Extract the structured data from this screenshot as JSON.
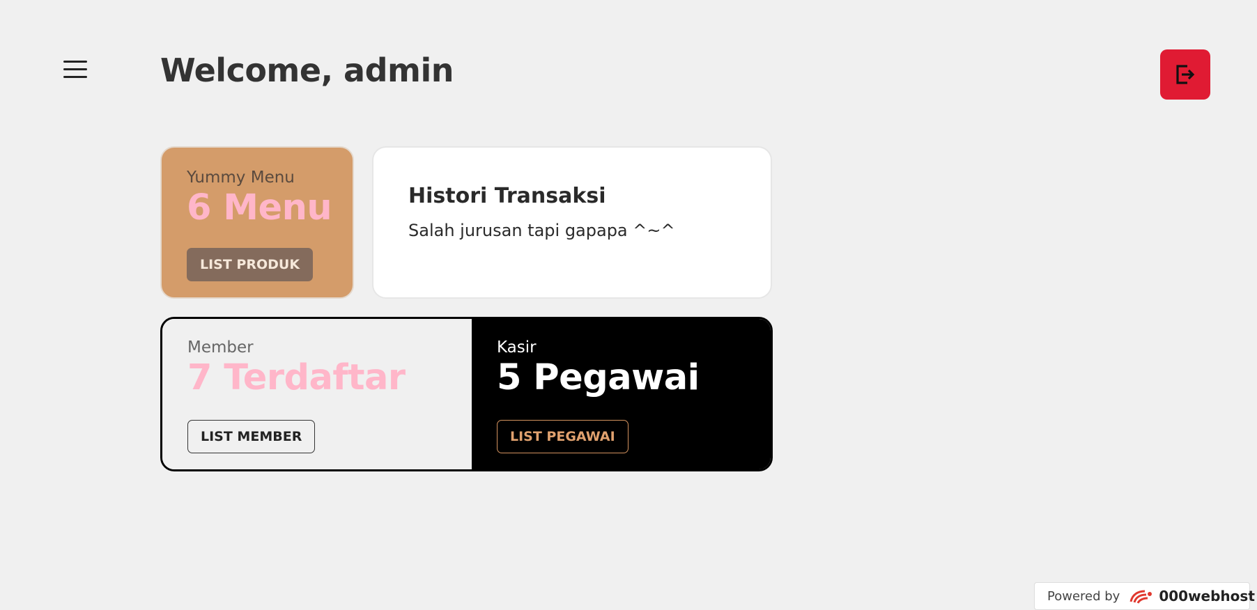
{
  "header": {
    "welcome": "Welcome, admin",
    "menu_icon": "hamburger-menu-icon",
    "logout_icon": "logout-icon",
    "logout_color": "#e01b33"
  },
  "cards": {
    "menu": {
      "label": "Yummy Menu",
      "value": "6 Menu",
      "button": "LIST PRODUK",
      "bg": "#d49c6a"
    },
    "histori": {
      "title": "Histori Transaksi",
      "subtitle": "Salah jurusan tapi gapapa ^~^"
    },
    "member": {
      "label": "Member",
      "value": "7 Terdaftar",
      "button": "LIST MEMBER"
    },
    "kasir": {
      "label": "Kasir",
      "value": "5 Pegawai",
      "button": "LIST PEGAWAI"
    }
  },
  "footer": {
    "powered_by": "Powered by",
    "brand": "000webhost"
  }
}
